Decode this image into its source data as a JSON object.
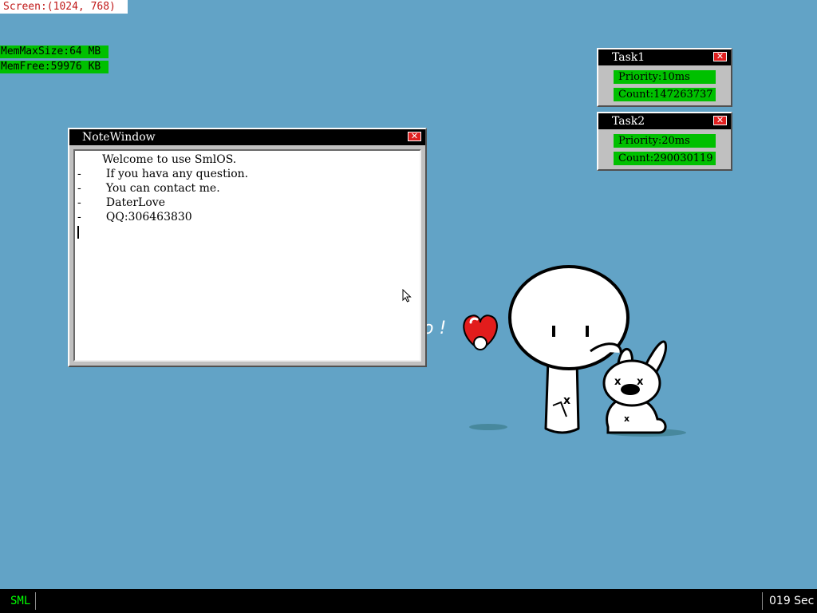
{
  "screen_label": "Screen:(1024, 768)",
  "memory": {
    "max_size": "MemMaxSize:64 MB",
    "free": "MemFree:59976 KB"
  },
  "note_window": {
    "title": "NoteWindow",
    "lines": [
      "       Welcome to use SmlOS.",
      "-       If you hava any question.",
      "-       You can contact me.",
      "-       DaterLove",
      "-       QQ:306463830"
    ]
  },
  "tasks": [
    {
      "title": "Task1",
      "priority": "Priority:10ms",
      "count": "Count:147263737"
    },
    {
      "title": "Task2",
      "priority": "Priority:20ms",
      "count": "Count:290030119"
    }
  ],
  "taskbar": {
    "start_label": "SML",
    "clock": "019 Sec"
  },
  "icons": {
    "close": "close-icon",
    "cursor": "arrow-cursor-icon"
  },
  "colors": {
    "desktop": "#62a3c6",
    "field_green": "#00c000",
    "close_red": "#e02020",
    "taskbar": "#000000",
    "start_label": "#00ff00"
  }
}
